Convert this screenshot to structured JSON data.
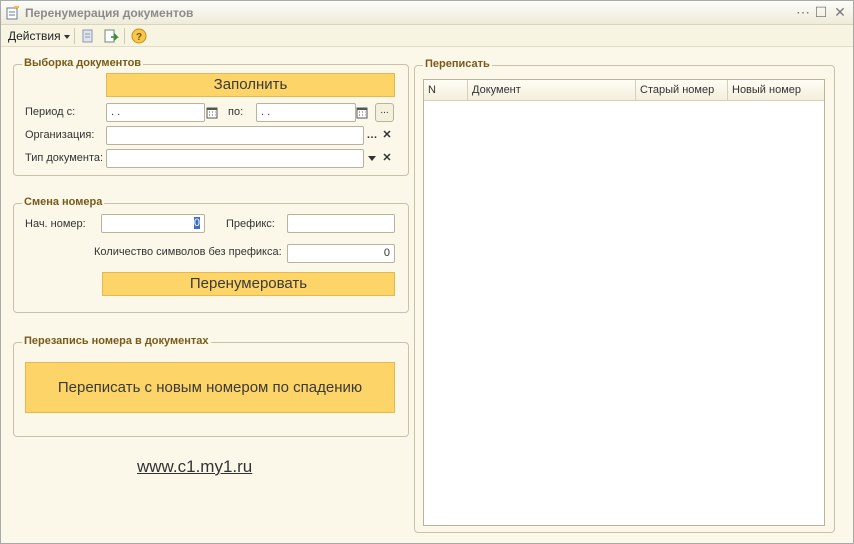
{
  "window": {
    "title": "Перенумерация документов",
    "icon": "document-edit-icon"
  },
  "toolbar": {
    "actions_label": "Действия",
    "icons": [
      "document-icon",
      "export-icon",
      "help-icon"
    ]
  },
  "selection": {
    "title": "Выборка документов",
    "fill_button": "Заполнить",
    "period_from_label": "Период с:",
    "period_from_value": ". .",
    "period_to_label": "по:",
    "period_to_value": ". .",
    "period_select_button": "...",
    "org_label": "Организация:",
    "org_value": "",
    "doctype_label": "Тип документа:",
    "doctype_value": ""
  },
  "numbering": {
    "title": "Смена номера",
    "start_label": "Нач. номер:",
    "start_value": "0",
    "prefix_label": "Префикс:",
    "prefix_value": "",
    "count_label": "Количество символов без префикса:",
    "count_value": "0",
    "renumber_button": "Перенумеровать"
  },
  "rewrite": {
    "title": "Перезапись номера в документах",
    "button": "Переписать с новым номером по спадению"
  },
  "table": {
    "title": "Переписать",
    "columns": [
      "N",
      "Документ",
      "Старый номер",
      "Новый номер"
    ],
    "rows": []
  },
  "footer": {
    "link": "www.c1.my1.ru"
  },
  "colors": {
    "accent": "#fdd467",
    "group_title": "#7a5a18",
    "background": "#fbf8ea"
  }
}
